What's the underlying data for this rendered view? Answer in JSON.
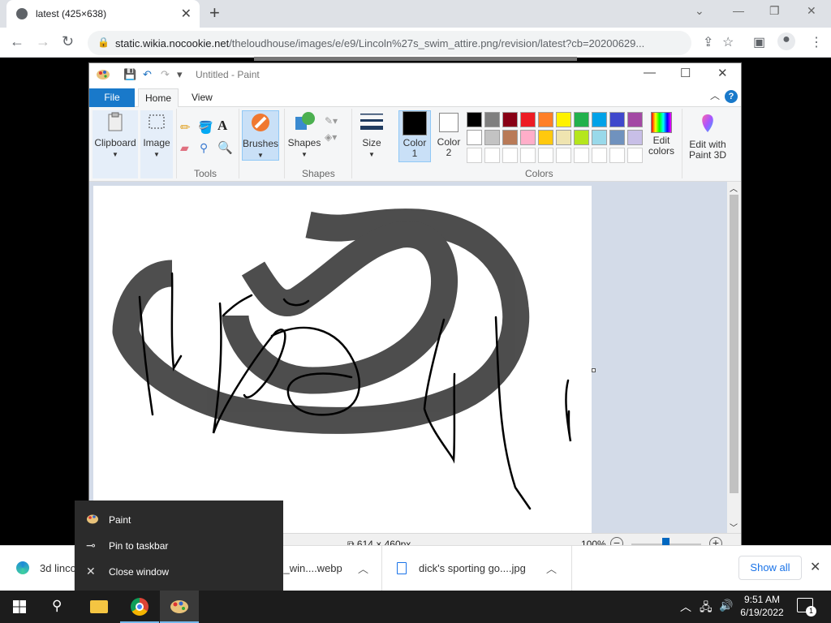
{
  "browser": {
    "tab_title": "latest (425×638)",
    "url_domain": "static.wikia.nocookie.net",
    "url_path": "/theloudhouse/images/e/e9/Lincoln%27s_swim_attire.png/revision/latest?cb=20200629..."
  },
  "paint": {
    "title": "Untitled - Paint",
    "tabs": [
      "File",
      "Home",
      "View"
    ],
    "clipboard": "Clipboard",
    "image": "Image",
    "tools_label": "Tools",
    "brushes": "Brushes",
    "shapes": "Shapes",
    "shapes_group": "Shapes",
    "size": "Size",
    "color1": "Color 1",
    "color2": "Color 2",
    "colors_group": "Colors",
    "edit_colors": "Edit colors",
    "edit_3d": "Edit with Paint 3D",
    "dimensions": "614 × 460px",
    "zoom": "100%",
    "palette_row1": [
      "#000000",
      "#7f7f7f",
      "#880015",
      "#ed1c24",
      "#ff7f27",
      "#fff200",
      "#22b14c",
      "#00a2e8",
      "#3f48cc",
      "#a349a4"
    ],
    "palette_row2": [
      "#ffffff",
      "#c3c3c3",
      "#b97a57",
      "#ffaec9",
      "#ffc90e",
      "#efe4b0",
      "#b5e61d",
      "#99d9ea",
      "#7092be",
      "#c8bfe7"
    ]
  },
  "downloads": [
    {
      "name": "3d linco",
      "icon": "edge-icon"
    },
    {
      "name": "s_win....webp",
      "icon": "file-icon"
    },
    {
      "name": "dick's sporting go....jpg",
      "icon": "image-file-icon"
    }
  ],
  "downloads_show_all": "Show all",
  "context_menu": [
    "Paint",
    "Pin to taskbar",
    "Close window"
  ],
  "clock": {
    "time": "9:51 AM",
    "date": "6/19/2022"
  },
  "notification_count": "1"
}
